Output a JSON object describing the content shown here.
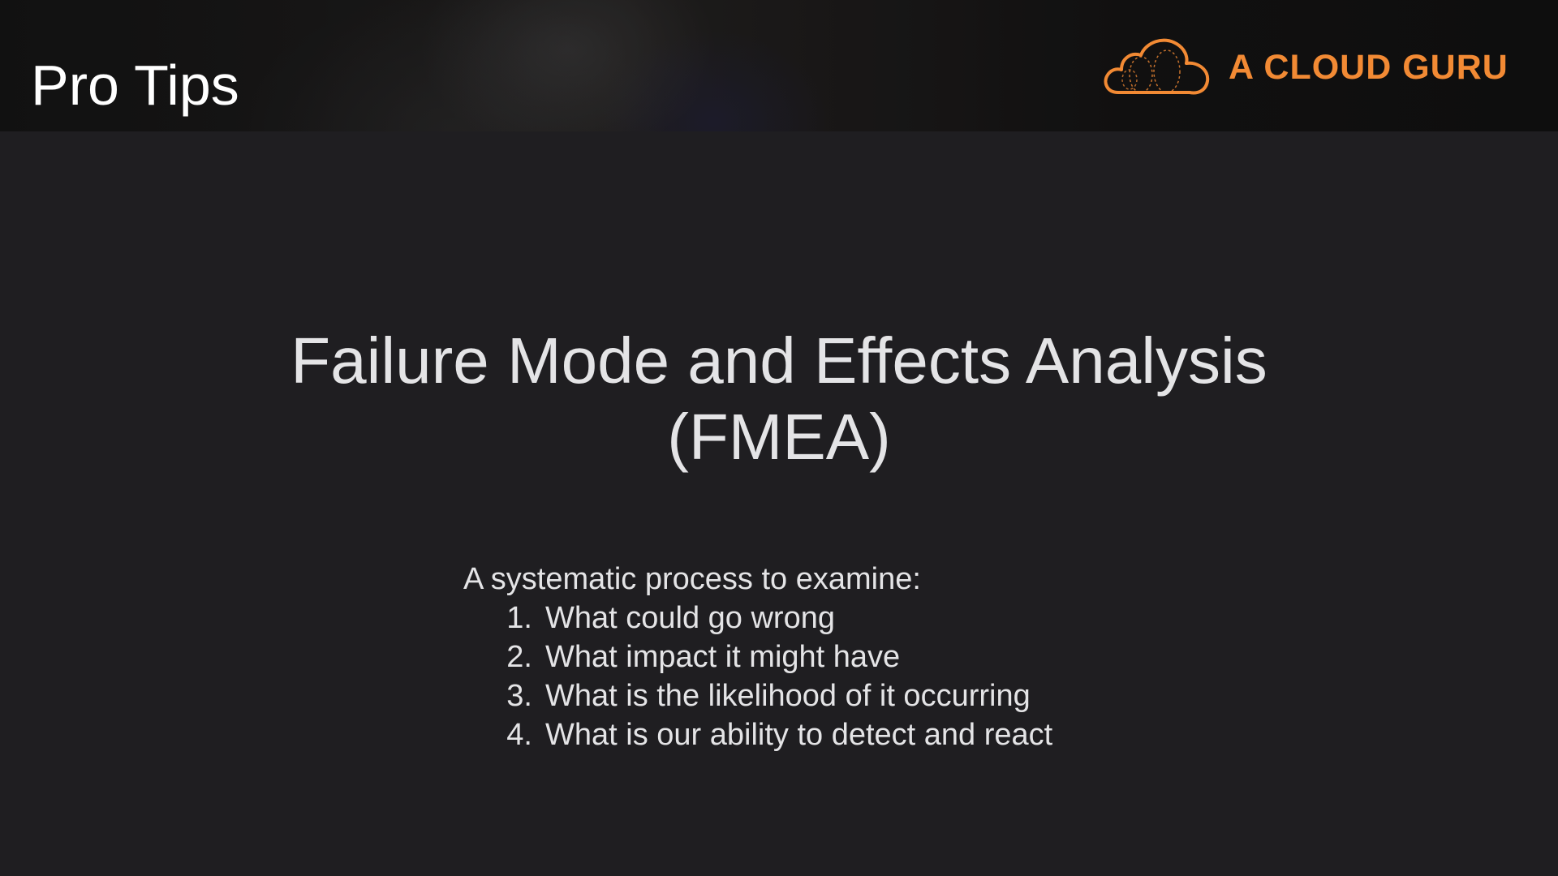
{
  "header": {
    "section_title": "Pro Tips",
    "brand": {
      "name": "A CLOUD GURU",
      "logo_icon": "cloud-logo-icon",
      "color": "#f28a34"
    }
  },
  "slide": {
    "title_line1": "Failure Mode and Effects Analysis",
    "title_line2": "(FMEA)",
    "intro": "A systematic process to examine:",
    "steps": [
      {
        "num": "1.",
        "text": "What could go wrong"
      },
      {
        "num": "2.",
        "text": "What impact it might have"
      },
      {
        "num": "3.",
        "text": "What is the likelihood of it occurring"
      },
      {
        "num": "4.",
        "text": "What is our ability to detect and react"
      }
    ]
  },
  "colors": {
    "background": "#1f1e21",
    "text": "#e4e4e6",
    "accent": "#f28a34"
  }
}
